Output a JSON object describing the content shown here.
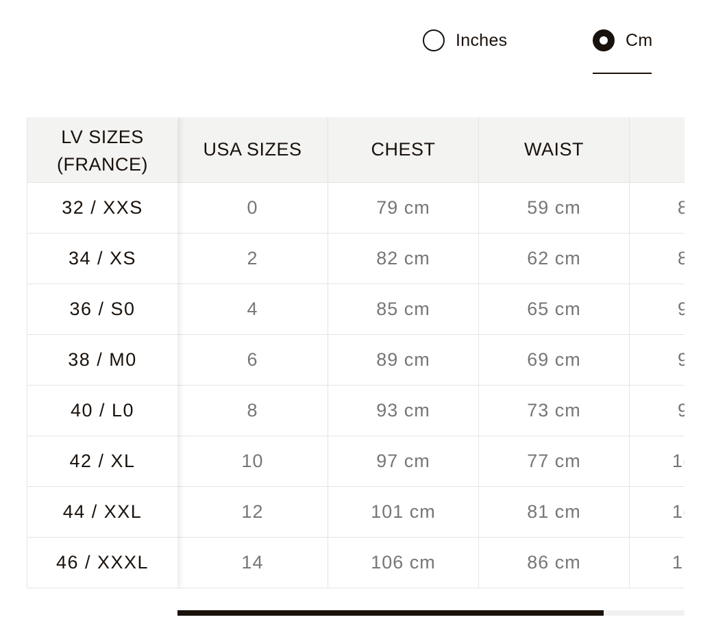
{
  "units": {
    "inches_label": "Inches",
    "cm_label": "Cm",
    "selected": "Cm"
  },
  "table": {
    "sticky_header": "LV SIZES\n(FRANCE)",
    "sticky_values": [
      "32 / XXS",
      "34 / XS",
      "36 / S0",
      "38 / M0",
      "40 / L0",
      "42 / XL",
      "44 / XXL",
      "46 / XXXL"
    ],
    "columns": [
      {
        "header": "USA SIZES",
        "values": [
          "0",
          "2",
          "4",
          "6",
          "8",
          "10",
          "12",
          "14"
        ]
      },
      {
        "header": "CHEST",
        "values": [
          "79 cm",
          "82 cm",
          "85 cm",
          "89 cm",
          "93 cm",
          "97 cm",
          "101 cm",
          "106 cm"
        ]
      },
      {
        "header": "WAIST",
        "values": [
          "59 cm",
          "62 cm",
          "65 cm",
          "69 cm",
          "73 cm",
          "77 cm",
          "81 cm",
          "86 cm"
        ]
      },
      {
        "header": "",
        "values": [
          "8",
          "8",
          "9",
          "9",
          "9",
          "1(",
          "1(",
          "1"
        ]
      }
    ]
  },
  "scrollbar": {
    "position_fraction": 0.84
  }
}
